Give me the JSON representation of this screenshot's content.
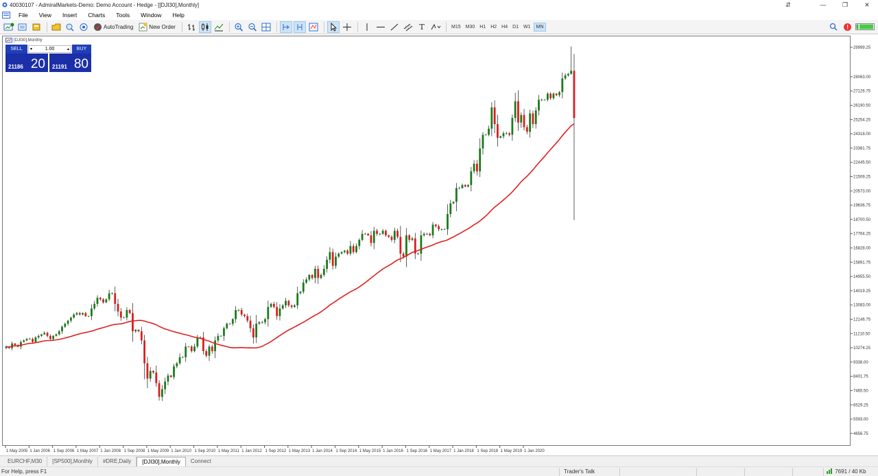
{
  "window": {
    "title": "40030107 - AdmiralMarkets-Demo: Demo Account - Hedge - [[DJI30],Monthly]"
  },
  "menu": [
    "File",
    "View",
    "Insert",
    "Charts",
    "Tools",
    "Window",
    "Help"
  ],
  "toolbar": {
    "autotrading_label": "AutoTrading",
    "neworder_label": "New Order",
    "timeframes": [
      "M15",
      "M30",
      "H1",
      "H2",
      "H4",
      "D1",
      "W1",
      "MN"
    ],
    "active_timeframe": "MN"
  },
  "chart": {
    "window_label": "[DJI30],Monthly",
    "trade_panel": {
      "sell_label": "SELL",
      "buy_label": "BUY",
      "lot": "1.00",
      "bid_small": "21186",
      "bid_big": "20",
      "ask_small": "21191",
      "ask_big": "80"
    }
  },
  "chart_data": {
    "type": "candlestick",
    "symbol": "[DJI30]",
    "timeframe": "Monthly",
    "ylim": [
      4200,
      30400
    ],
    "y_ticks": [
      "29999.25",
      "28063.00",
      "27126.75",
      "26190.50",
      "25254.25",
      "24318.00",
      "23381.75",
      "22445.50",
      "21509.25",
      "20573.00",
      "19636.75",
      "18700.50",
      "17764.25",
      "16828.00",
      "15891.75",
      "14955.50",
      "14019.25",
      "13083.00",
      "12146.75",
      "11210.50",
      "10274.25",
      "9338.00",
      "8401.75",
      "7465.50",
      "6529.25",
      "5593.00",
      "4656.75"
    ],
    "x_ticks": [
      "1 May 2005",
      "1 Jan 2006",
      "1 Sep 2006",
      "1 May 2007",
      "1 Jan 2008",
      "1 Sep 2008",
      "1 May 2009",
      "1 Jan 2010",
      "1 Sep 2010",
      "1 May 2011",
      "1 Jan 2012",
      "1 Sep 2012",
      "1 May 2013",
      "1 Jan 2014",
      "1 Sep 2014",
      "1 May 2015",
      "1 Jan 2016",
      "1 Sep 2016",
      "1 May 2017",
      "1 Jan 2018",
      "1 Sep 2018",
      "1 May 2019",
      "1 Jan 2020"
    ],
    "start": "2005-05",
    "series": [
      {
        "values": [
          10400,
          10300,
          10600,
          10500,
          10400,
          10700,
          10800,
          10900,
          10900,
          10700,
          11000,
          11100,
          11200,
          11300,
          11100,
          10900,
          11100,
          11200,
          11400,
          11700,
          11900,
          12100,
          12300,
          12500,
          12600,
          12500,
          12600,
          12400,
          12400,
          12900,
          13200,
          13600,
          13500,
          13300,
          13500,
          13900,
          13900,
          13200,
          12700,
          12300,
          12300,
          12800,
          12600,
          11400,
          11500,
          11400,
          10800,
          9300,
          8300,
          8800,
          8700,
          8000,
          7100,
          7600,
          8100,
          8500,
          8400,
          9100,
          9300,
          9700,
          9700,
          10400,
          10400,
          10100,
          10400,
          11000,
          11000,
          10100,
          9800,
          10400,
          10100,
          10800,
          11100,
          11100,
          11600,
          11900,
          11900,
          12200,
          12800,
          12800,
          12500,
          12400,
          12100,
          11600,
          11000,
          11900,
          12000,
          12000,
          12200,
          13000,
          13200,
          13000,
          12400,
          12900,
          13100,
          13400,
          13100,
          13000,
          13100,
          13900,
          14000,
          14600,
          14800,
          15100,
          14900,
          15500,
          14900,
          15100,
          15500,
          16100,
          16600,
          15700,
          16300,
          16500,
          16600,
          16700,
          16500,
          17000,
          16600,
          17000,
          17400,
          17800,
          17800,
          17700,
          17200,
          18000,
          17800,
          17800,
          18000,
          17700,
          17600,
          17400,
          18000,
          17600,
          16500,
          16300,
          17700,
          17400,
          17500,
          16500,
          16500,
          17700,
          17800,
          17800,
          17700,
          18400,
          18300,
          18100,
          18100,
          18100,
          19100,
          19800,
          19900,
          20800,
          20800,
          21000,
          20900,
          21000,
          21900,
          22400,
          21900,
          23400,
          24300,
          24300,
          24700,
          26100,
          25000,
          24100,
          24200,
          24400,
          24400,
          24300,
          25400,
          26500,
          25100,
          25600,
          24800,
          24500,
          25700,
          25000,
          25900,
          26600,
          26600,
          26600,
          27000,
          26700,
          27000,
          26900,
          27100,
          28000,
          28200,
          28300,
          28500,
          25400
        ],
        "period": 40
      }
    ]
  }
}
